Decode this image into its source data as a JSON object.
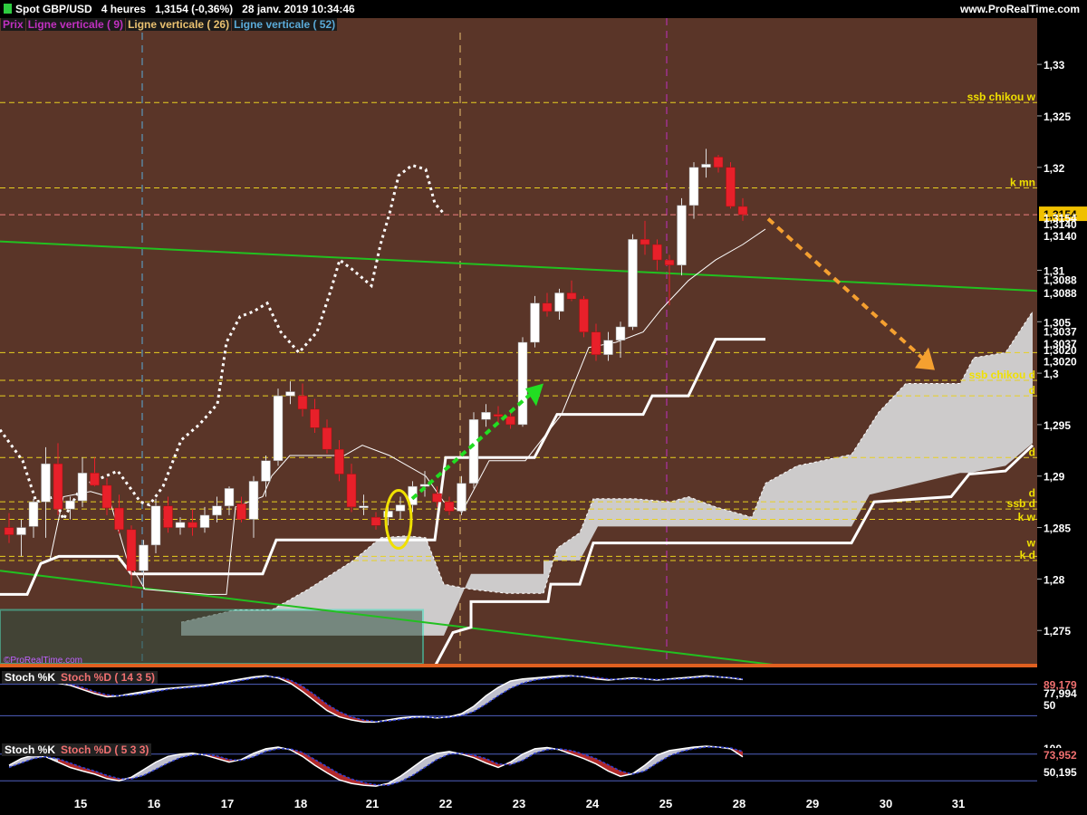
{
  "header": {
    "instrument": "Spot GBP/USD",
    "timeframe": "4 heures",
    "price_change": "1,3154 (-0,36%)",
    "datetime": "28 janv. 2019 10:34:46",
    "website": "www.ProRealTime.com"
  },
  "legend": {
    "price": "Prix",
    "vline1": "Ligne verticale ( 9)",
    "vline2": "Ligne verticale ( 26)",
    "vline3": "Ligne verticale ( 52)"
  },
  "copyright": "©ProRealTime.com",
  "colors": {
    "background": "#5a3528",
    "bull": "#ffffff",
    "bear": "#e8202a",
    "trendline": "#22c020",
    "kijun": "#ffffff",
    "cloud": "#d4d4d4",
    "yellow_level": "#e8d020",
    "forecast_arrow": "#f5a030",
    "green_arrow": "#22dd22",
    "vline9": "#5aaad8",
    "vline26": "#e8c070",
    "vline52": "#c030c0",
    "box": "#40e0c0"
  },
  "chart_data": {
    "type": "candlestick",
    "x_tick_labels": [
      "15",
      "16",
      "17",
      "18",
      "21",
      "22",
      "23",
      "24",
      "25",
      "28",
      "29",
      "30",
      "31"
    ],
    "y_tick_labels": [
      "1,33",
      "1,325",
      "1,32",
      "1,31",
      "1,305",
      "1,3",
      "1,295",
      "1,29",
      "1,285",
      "1,28",
      "1,275"
    ],
    "ylim": [
      1.2715,
      1.3345
    ],
    "price_labels": {
      "last": "1,3154",
      "tenkan": "1,3154",
      "l3140a": "1,3140",
      "l3140b": "1,3140",
      "l3088a": "1,3088",
      "l3088b": "1,3088",
      "l3037a": "1,3037",
      "l3037b": "1,3037",
      "l3020a": "1,3020",
      "l3020b": "1,3020"
    },
    "level_labels": {
      "ssb_chikou_w": "ssb chikou w",
      "k_mn": "k mn",
      "ssb_chikou_d": "ssb chikou d",
      "d1": "d",
      "d2": "d",
      "d3": "d",
      "ssb_d": "ssb d",
      "k_w": "k w",
      "w": "w",
      "k_d": "k d"
    },
    "levels": [
      1.3263,
      1.318,
      1.302,
      1.2993,
      1.2978,
      1.2918,
      1.2875,
      1.2868,
      1.2858,
      1.2822,
      1.2818
    ],
    "candles": [
      {
        "o": 1.285,
        "h": 1.2864,
        "l": 1.2835,
        "c": 1.2843
      },
      {
        "o": 1.2843,
        "h": 1.2858,
        "l": 1.2822,
        "c": 1.285
      },
      {
        "o": 1.2851,
        "h": 1.2878,
        "l": 1.284,
        "c": 1.2875
      },
      {
        "o": 1.2875,
        "h": 1.2928,
        "l": 1.284,
        "c": 1.2912
      },
      {
        "o": 1.2912,
        "h": 1.2932,
        "l": 1.2862,
        "c": 1.2868
      },
      {
        "o": 1.2868,
        "h": 1.288,
        "l": 1.2858,
        "c": 1.2876
      },
      {
        "o": 1.2876,
        "h": 1.2918,
        "l": 1.287,
        "c": 1.2903
      },
      {
        "o": 1.2903,
        "h": 1.2918,
        "l": 1.289,
        "c": 1.2891
      },
      {
        "o": 1.2891,
        "h": 1.2898,
        "l": 1.2862,
        "c": 1.2869
      },
      {
        "o": 1.2869,
        "h": 1.2882,
        "l": 1.2844,
        "c": 1.2848
      },
      {
        "o": 1.2848,
        "h": 1.2852,
        "l": 1.2792,
        "c": 1.2808
      },
      {
        "o": 1.2808,
        "h": 1.2838,
        "l": 1.279,
        "c": 1.2833
      },
      {
        "o": 1.2833,
        "h": 1.2878,
        "l": 1.2825,
        "c": 1.2871
      },
      {
        "o": 1.2871,
        "h": 1.288,
        "l": 1.2845,
        "c": 1.285
      },
      {
        "o": 1.285,
        "h": 1.286,
        "l": 1.2843,
        "c": 1.2855
      },
      {
        "o": 1.2855,
        "h": 1.2868,
        "l": 1.2842,
        "c": 1.285
      },
      {
        "o": 1.285,
        "h": 1.287,
        "l": 1.2845,
        "c": 1.2862
      },
      {
        "o": 1.2862,
        "h": 1.288,
        "l": 1.2855,
        "c": 1.2871
      },
      {
        "o": 1.2871,
        "h": 1.289,
        "l": 1.2862,
        "c": 1.2888
      },
      {
        "o": 1.2873,
        "h": 1.288,
        "l": 1.2855,
        "c": 1.2858
      },
      {
        "o": 1.2858,
        "h": 1.29,
        "l": 1.284,
        "c": 1.2895
      },
      {
        "o": 1.2895,
        "h": 1.292,
        "l": 1.288,
        "c": 1.2915
      },
      {
        "o": 1.2915,
        "h": 1.2985,
        "l": 1.291,
        "c": 1.2978
      },
      {
        "o": 1.2978,
        "h": 1.2992,
        "l": 1.297,
        "c": 1.2982
      },
      {
        "o": 1.2978,
        "h": 1.299,
        "l": 1.2958,
        "c": 1.2965
      },
      {
        "o": 1.2965,
        "h": 1.2975,
        "l": 1.2942,
        "c": 1.2947
      },
      {
        "o": 1.2947,
        "h": 1.2955,
        "l": 1.2922,
        "c": 1.2926
      },
      {
        "o": 1.2926,
        "h": 1.2935,
        "l": 1.2895,
        "c": 1.2902
      },
      {
        "o": 1.2902,
        "h": 1.2912,
        "l": 1.2865,
        "c": 1.287
      },
      {
        "o": 1.287,
        "h": 1.2882,
        "l": 1.2862,
        "c": 1.2871
      },
      {
        "o": 1.286,
        "h": 1.2865,
        "l": 1.2848,
        "c": 1.2852
      },
      {
        "o": 1.286,
        "h": 1.2875,
        "l": 1.2852,
        "c": 1.2866
      },
      {
        "o": 1.2866,
        "h": 1.288,
        "l": 1.2858,
        "c": 1.2872
      },
      {
        "o": 1.2872,
        "h": 1.2895,
        "l": 1.2865,
        "c": 1.289
      },
      {
        "o": 1.289,
        "h": 1.2905,
        "l": 1.288,
        "c": 1.2892
      },
      {
        "o": 1.2883,
        "h": 1.289,
        "l": 1.287,
        "c": 1.2875
      },
      {
        "o": 1.2875,
        "h": 1.288,
        "l": 1.2862,
        "c": 1.2866
      },
      {
        "o": 1.2866,
        "h": 1.29,
        "l": 1.2862,
        "c": 1.2893
      },
      {
        "o": 1.2893,
        "h": 1.2962,
        "l": 1.2888,
        "c": 1.2955
      },
      {
        "o": 1.2955,
        "h": 1.297,
        "l": 1.2948,
        "c": 1.2962
      },
      {
        "o": 1.296,
        "h": 1.2968,
        "l": 1.2952,
        "c": 1.2958
      },
      {
        "o": 1.2958,
        "h": 1.2962,
        "l": 1.2946,
        "c": 1.295
      },
      {
        "o": 1.295,
        "h": 1.3035,
        "l": 1.2948,
        "c": 1.303
      },
      {
        "o": 1.303,
        "h": 1.3075,
        "l": 1.3025,
        "c": 1.3068
      },
      {
        "o": 1.3068,
        "h": 1.3078,
        "l": 1.3055,
        "c": 1.306
      },
      {
        "o": 1.306,
        "h": 1.3082,
        "l": 1.3052,
        "c": 1.3078
      },
      {
        "o": 1.3078,
        "h": 1.309,
        "l": 1.307,
        "c": 1.3072
      },
      {
        "o": 1.3072,
        "h": 1.3075,
        "l": 1.3035,
        "c": 1.304
      },
      {
        "o": 1.304,
        "h": 1.3048,
        "l": 1.3012,
        "c": 1.3018
      },
      {
        "o": 1.3018,
        "h": 1.304,
        "l": 1.3012,
        "c": 1.3032
      },
      {
        "o": 1.3032,
        "h": 1.305,
        "l": 1.3015,
        "c": 1.3045
      },
      {
        "o": 1.3045,
        "h": 1.3135,
        "l": 1.3042,
        "c": 1.313
      },
      {
        "o": 1.313,
        "h": 1.3148,
        "l": 1.3115,
        "c": 1.3125
      },
      {
        "o": 1.3125,
        "h": 1.313,
        "l": 1.31,
        "c": 1.311
      },
      {
        "o": 1.311,
        "h": 1.3115,
        "l": 1.3066,
        "c": 1.3105
      },
      {
        "o": 1.3105,
        "h": 1.317,
        "l": 1.3095,
        "c": 1.3163
      },
      {
        "o": 1.3163,
        "h": 1.3205,
        "l": 1.315,
        "c": 1.32
      },
      {
        "o": 1.32,
        "h": 1.3218,
        "l": 1.319,
        "c": 1.3203
      },
      {
        "o": 1.321,
        "h": 1.3212,
        "l": 1.3195,
        "c": 1.32
      },
      {
        "o": 1.32,
        "h": 1.3205,
        "l": 1.316,
        "c": 1.3162
      },
      {
        "o": 1.3162,
        "h": 1.317,
        "l": 1.3148,
        "c": 1.3154
      }
    ],
    "stoch1": {
      "title": "Stoch %K",
      "title2": "Stoch %D ( 14 3 5)",
      "label_k": "89,179",
      "label_d": "77,994",
      "label_50": "50",
      "k": [
        85,
        88,
        86,
        84,
        82,
        78,
        70,
        62,
        56,
        58,
        62,
        66,
        70,
        72,
        74,
        76,
        78,
        82,
        86,
        90,
        94,
        96,
        92,
        82,
        66,
        48,
        30,
        18,
        12,
        8,
        8,
        12,
        16,
        18,
        18,
        16,
        18,
        24,
        38,
        58,
        74,
        86,
        90,
        92,
        94,
        96,
        96,
        94,
        90,
        88,
        90,
        92,
        90,
        88,
        90,
        92,
        94,
        96,
        94,
        92,
        89
      ],
      "d": [
        82,
        84,
        86,
        85,
        83,
        80,
        74,
        66,
        60,
        58,
        59,
        62,
        66,
        70,
        72,
        74,
        76,
        79,
        83,
        87,
        91,
        94,
        94,
        88,
        76,
        60,
        42,
        28,
        18,
        12,
        9,
        10,
        13,
        16,
        17,
        17,
        17,
        20,
        28,
        42,
        58,
        72,
        82,
        88,
        91,
        93,
        95,
        95,
        93,
        90,
        89,
        90,
        90,
        89,
        89,
        90,
        92,
        94,
        94,
        93,
        90
      ]
    },
    "stoch2": {
      "title": "Stoch %K",
      "title2": "Stoch %D ( 5 3 3)",
      "label_top": "100",
      "label_k": "73,952",
      "label_d": "50,195",
      "k": [
        55,
        70,
        78,
        74,
        62,
        50,
        42,
        35,
        25,
        20,
        28,
        45,
        62,
        75,
        80,
        82,
        78,
        70,
        62,
        68,
        82,
        92,
        96,
        90,
        75,
        55,
        38,
        22,
        14,
        10,
        8,
        14,
        30,
        50,
        70,
        82,
        86,
        80,
        72,
        60,
        50,
        62,
        80,
        92,
        95,
        90,
        80,
        70,
        58,
        42,
        30,
        36,
        55,
        78,
        88,
        92,
        96,
        98,
        96,
        92,
        74
      ],
      "d": [
        50,
        60,
        70,
        74,
        70,
        60,
        50,
        42,
        32,
        25,
        24,
        32,
        46,
        60,
        72,
        78,
        80,
        76,
        68,
        66,
        74,
        86,
        92,
        92,
        84,
        68,
        52,
        36,
        24,
        16,
        11,
        10,
        18,
        32,
        50,
        68,
        80,
        82,
        78,
        70,
        58,
        56,
        66,
        82,
        90,
        92,
        88,
        80,
        70,
        56,
        42,
        35,
        42,
        60,
        76,
        86,
        92,
        96,
        96,
        94,
        86
      ]
    }
  }
}
